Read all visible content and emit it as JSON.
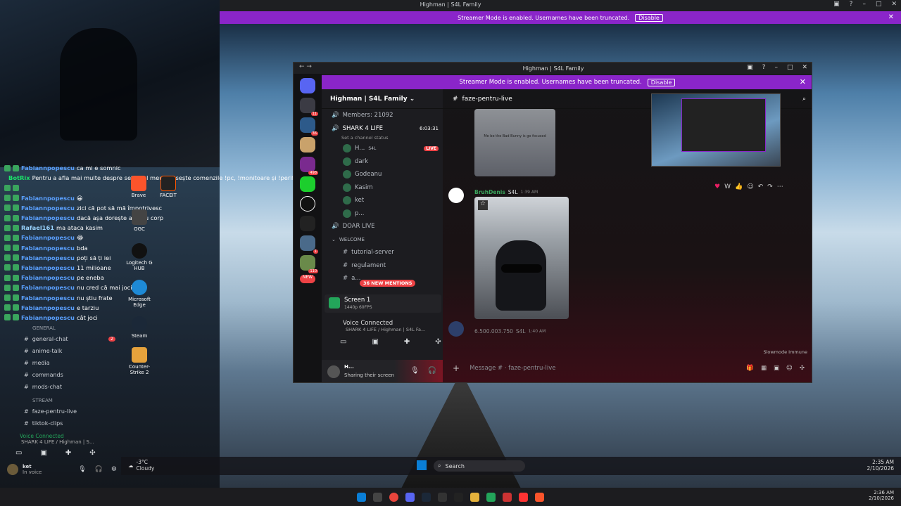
{
  "topbar": {
    "title": "Highman | S4L Family",
    "controls": [
      "▣",
      "?",
      "–",
      "□",
      "✕"
    ]
  },
  "banner": {
    "text": "Streamer Mode is enabled. Usernames have been truncated.",
    "button": "Disable",
    "close": "✕"
  },
  "chat": [
    {
      "user": "Fabiannpopescu",
      "msg": "ca mi e somnic",
      "cls": "u"
    },
    {
      "user": "BotRix",
      "msg": "Pentru a afla mai multe despre setup-ul meu folosește comenzile !pc, !monitoare și !periferice",
      "cls": "g"
    },
    {
      "user": "",
      "msg": "",
      "cls": "u"
    },
    {
      "user": "Fabiannpopescu",
      "msg": "😀",
      "cls": "u"
    },
    {
      "user": "Fabiannpopescu",
      "msg": "zici că pot să mă împotrivesc",
      "cls": "u"
    },
    {
      "user": "Fabiannpopescu",
      "msg": "dacă așa dorește al meu corp",
      "cls": "u"
    },
    {
      "user": "Rafael161",
      "msg": "ma ataca kasim",
      "cls": "r"
    },
    {
      "user": "Fabiannpopescu",
      "msg": "😂",
      "cls": "u"
    },
    {
      "user": "Fabiannpopescu",
      "msg": "bda",
      "cls": "u"
    },
    {
      "user": "Fabiannpopescu",
      "msg": "poți să ți iei",
      "cls": "u"
    },
    {
      "user": "Fabiannpopescu",
      "msg": "11 milioane",
      "cls": "u"
    },
    {
      "user": "Fabiannpopescu",
      "msg": "pe eneba",
      "cls": "u"
    },
    {
      "user": "Fabiannpopescu",
      "msg": "nu cred că mai joci re",
      "cls": "u"
    },
    {
      "user": "Fabiannpopescu",
      "msg": "nu știu frate",
      "cls": "u"
    },
    {
      "user": "Fabiannpopescu",
      "msg": "e tarziu",
      "cls": "u"
    },
    {
      "user": "Fabiannpopescu",
      "msg": "cât joci",
      "cls": "u"
    }
  ],
  "desktop_icons": [
    {
      "label": "Brave"
    },
    {
      "label": "FACEIT"
    },
    {
      "label": "OGC"
    },
    {
      "label": "Logitech G HUB"
    },
    {
      "label": "Microsoft Edge"
    },
    {
      "label": "Steam"
    },
    {
      "label": "Counter-Strike 2"
    }
  ],
  "left_sidebar": {
    "cat_general": "GENERAL",
    "channels": [
      {
        "name": "general-chat",
        "badge": "2"
      },
      {
        "name": "anime-talk",
        "badge": ""
      },
      {
        "name": "media",
        "badge": ""
      },
      {
        "name": "commands",
        "badge": ""
      },
      {
        "name": "mods-chat",
        "badge": ""
      }
    ],
    "cat_stream": "STREAM",
    "stream_channels": [
      {
        "name": "faze-pentru-live"
      },
      {
        "name": "tiktok-clips"
      }
    ],
    "voice_connected": "Voice Connected",
    "voice_sub": "SHARK 4 LIFE / Highman | S...",
    "user": "ket",
    "user_status": "In voice"
  },
  "window": {
    "title": "Highman | S4L Family",
    "banner_text": "Streamer Mode is enabled. Usernames have been truncated.",
    "banner_button": "Disable",
    "server_name": "Highman | S4L Family",
    "members": "Members: 21092",
    "voice_channel": "SHARK 4 LIFE",
    "voice_time": "6:03:31",
    "set_status": "Set a channel status",
    "users": [
      {
        "name": "H...",
        "tag": "S4L",
        "live": "LIVE"
      },
      {
        "name": "dark",
        "tag": "",
        "live": ""
      },
      {
        "name": "Godeanu",
        "tag": "",
        "live": ""
      },
      {
        "name": "Kasim",
        "tag": "",
        "live": ""
      },
      {
        "name": "ket",
        "tag": "",
        "live": ""
      },
      {
        "name": "p...",
        "tag": "",
        "live": ""
      }
    ],
    "doar_live": "DOAR LIVE",
    "welcome": "WELCOME",
    "welcome_channels": [
      "tutorial-server",
      "regulament",
      "a..."
    ],
    "mentions": "36 NEW MENTIONS",
    "new": "NEW",
    "screen_title": "Screen 1",
    "screen_sub": "1440p 60FPS",
    "voice_connected": "Voice Connected",
    "voice_sub": "SHARK 4 LIFE / Highman | S4L Fa...",
    "user_name": "H...",
    "user_status": "Sharing their screen",
    "channel": "faze-pentru-live",
    "thumb_caption": "Me be the Bad Bunny is go focused",
    "msg_author": "BruhDenis",
    "msg_tag": "S4L",
    "msg_time": "1:39 AM",
    "msg2_author": "6.500.003.750",
    "msg2_tag": "S4L",
    "msg2_time": "1:40 AM",
    "slowmode": "Slowmode Immune",
    "placeholder": "Message # · faze-pentru-live",
    "server_badges": [
      "11",
      "36",
      "498",
      "1",
      "110"
    ]
  },
  "desk_taskbar": {
    "search": "Search",
    "weather": "-3°C",
    "weather_sub": "Cloudy",
    "time": "2:35 AM",
    "date": "2/10/2026"
  },
  "taskbar": {
    "time": "2:36 AM",
    "date": "2/10/2026"
  }
}
